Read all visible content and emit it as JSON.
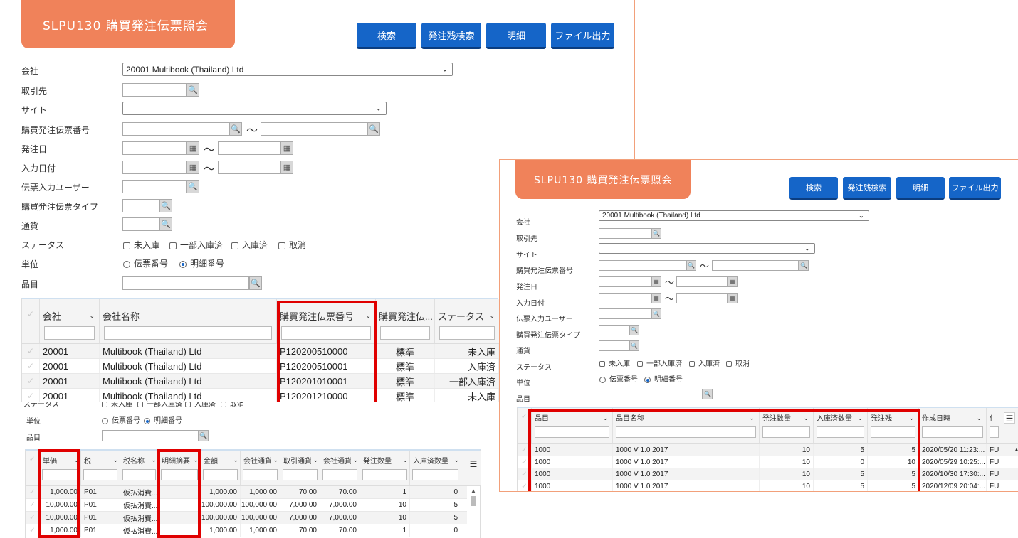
{
  "title": "SLPU130 購買発注伝票照会",
  "buttons": {
    "search": "検索",
    "remaining": "発注残検索",
    "detail": "明細",
    "export": "ファイル出力"
  },
  "labels": {
    "company": "会社",
    "partner": "取引先",
    "site": "サイト",
    "po_number": "購買発注伝票番号",
    "order_date": "発注日",
    "input_date": "入力日付",
    "input_user": "伝票入力ユーザー",
    "po_type": "購買発注伝票タイプ",
    "currency": "通貨",
    "status": "ステータス",
    "unit": "単位",
    "item": "品目"
  },
  "company_value": "20001 Multibook (Thailand) Ltd",
  "tilde": "〜",
  "status_options": [
    "未入庫",
    "一部入庫済",
    "入庫済",
    "取消"
  ],
  "unit_options": [
    "伝票番号",
    "明細番号"
  ],
  "panel1_grid": {
    "headers": [
      "会社",
      "会社名称",
      "購買発注伝票番号",
      "購買発注伝...",
      "ステータス"
    ],
    "rows": [
      [
        "20001",
        "Multibook (Thailand) Ltd",
        "P120200510000",
        "標準",
        "未入庫"
      ],
      [
        "20001",
        "Multibook (Thailand) Ltd",
        "P120200510001",
        "標準",
        "入庫済"
      ],
      [
        "20001",
        "Multibook (Thailand) Ltd",
        "P120201010001",
        "標準",
        "一部入庫済"
      ],
      [
        "20001",
        "Multibook (Thailand) Ltd",
        "P120201210000",
        "標準",
        "未入庫"
      ]
    ]
  },
  "panel2": {
    "status_partial": [
      "ステータス",
      "未入庫",
      "一部入庫済",
      "入庫済",
      "取消"
    ],
    "headers": [
      "単価",
      "税",
      "税名称",
      "明細摘要...",
      "金額",
      "会社通貨...",
      "取引通貨...",
      "会社通貨...",
      "発注数量",
      "入庫済数量"
    ],
    "rows": [
      [
        "1,000.00",
        "P01",
        "仮払消費...",
        "",
        "1,000.00",
        "1,000.00",
        "70.00",
        "70.00",
        "1",
        "0"
      ],
      [
        "10,000.00",
        "P01",
        "仮払消費...",
        "",
        "100,000.00",
        "100,000.00",
        "7,000.00",
        "7,000.00",
        "10",
        "5"
      ],
      [
        "10,000.00",
        "P01",
        "仮払消費...",
        "",
        "100,000.00",
        "100,000.00",
        "7,000.00",
        "7,000.00",
        "10",
        "5"
      ],
      [
        "1,000.00",
        "P01",
        "仮払消費...",
        "",
        "1,000.00",
        "1,000.00",
        "70.00",
        "70.00",
        "1",
        "0"
      ]
    ]
  },
  "panel3_grid": {
    "headers": [
      "品目",
      "品目名称",
      "発注数量",
      "入庫済数量",
      "発注残",
      "作成日時",
      "作"
    ],
    "rows": [
      [
        "1000",
        "1000 V 1.0 2017",
        "10",
        "5",
        "5",
        "2020/05/20 11:23:...",
        "FU"
      ],
      [
        "1000",
        "1000 V 1.0 2017",
        "10",
        "0",
        "10",
        "2020/05/29 10:25:...",
        "FU"
      ],
      [
        "1000",
        "1000 V 1.0 2017",
        "10",
        "5",
        "5",
        "2020/10/30 17:30:...",
        "FU"
      ],
      [
        "1000",
        "1000 V 1.0 2017",
        "10",
        "5",
        "5",
        "2020/12/09 20:04:...",
        "FU"
      ]
    ]
  },
  "icons": {
    "search": "magnifier-icon",
    "calendar": "calendar-icon",
    "dropdown": "chevron-down-icon",
    "menu": "hamburger-icon"
  },
  "colors": {
    "accent": "#f0825a",
    "button": "#1565c8",
    "highlight": "#e00000"
  }
}
